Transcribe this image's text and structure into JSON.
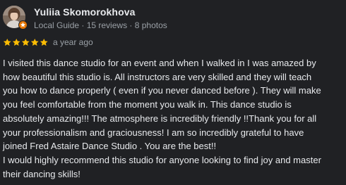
{
  "author": {
    "name": "Yuliia Skomorokhova",
    "meta": "Local Guide · 15 reviews · 8 photos",
    "avatar_icon": "profile-photo",
    "badge_icon": "local-guide-star-icon"
  },
  "rating": {
    "stars": 5,
    "max_stars": 5,
    "star_color": "#fbbc04",
    "date": "a year ago"
  },
  "review": {
    "lines": [
      "I visited this dance studio for an event and when I walked in I was amazed by",
      "how beautiful this studio is. All instructors are very skilled and they will teach",
      "you how to dance properly ( even if you never danced before ). They will make",
      "you feel comfortable from the moment you walk in. This dance studio is",
      "absolutely amazing!!! The atmosphere is incredibly friendly !!Thank you for all",
      "your professionalism and graciousness! I am so incredibly grateful to have",
      "joined Fred Astaire Dance Studio . You are the best!!",
      "I would highly recommend this studio for anyone looking to find joy and master",
      "their dancing skills!"
    ]
  },
  "colors": {
    "background": "#202124",
    "primary_text": "#e8eaed",
    "secondary_text": "#9aa0a6",
    "badge": "#e37400"
  }
}
